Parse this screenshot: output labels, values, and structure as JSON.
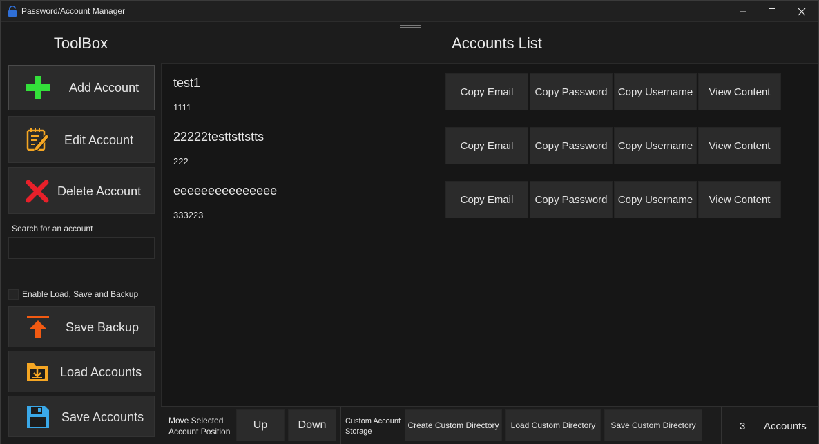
{
  "window": {
    "title": "Password/Account Manager",
    "controls": {
      "minimize": "minimize-icon",
      "maximize": "maximize-icon",
      "close": "close-icon"
    }
  },
  "sidebar": {
    "title": "ToolBox",
    "buttons": {
      "add": {
        "label": "Add Account",
        "icon": "plus-icon"
      },
      "edit": {
        "label": "Edit Account",
        "icon": "notepad-pencil-icon"
      },
      "delete": {
        "label": "Delete Account",
        "icon": "red-x-icon"
      },
      "backup": {
        "label": "Save Backup",
        "icon": "upload-arrow-icon"
      },
      "load": {
        "label": "Load Accounts",
        "icon": "folder-download-icon"
      },
      "save": {
        "label": "Save Accounts",
        "icon": "floppy-disk-icon"
      }
    },
    "search": {
      "label": "Search for an account",
      "value": "",
      "placeholder": ""
    },
    "enable_checkbox": {
      "label": "Enable Load, Save and Backup",
      "checked": false
    }
  },
  "main": {
    "title": "Accounts List",
    "action_labels": {
      "copy_email": "Copy Email",
      "copy_password": "Copy Password",
      "copy_username": "Copy Username",
      "view_content": "View Content"
    },
    "accounts": [
      {
        "name": "test1",
        "sub": "1111"
      },
      {
        "name": "22222testtsttstts",
        "sub": "222"
      },
      {
        "name": "eeeeeeeeeeeeeee",
        "sub": "333223"
      }
    ]
  },
  "bottom": {
    "move_label_1": "Move Selected",
    "move_label_2": "Account Position",
    "up": "Up",
    "down": "Down",
    "custom_label_1": "Custom Account",
    "custom_label_2": "Storage",
    "create_dir": "Create Custom Directory",
    "load_dir": "Load Custom Directory",
    "save_dir": "Save Custom Directory",
    "count": "3",
    "count_label": "Accounts"
  },
  "colors": {
    "accent_green": "#33e03a",
    "accent_red": "#e8202a",
    "accent_orange": "#f25a12",
    "accent_folder": "#f5a623",
    "accent_floppy": "#3aa8e8"
  }
}
